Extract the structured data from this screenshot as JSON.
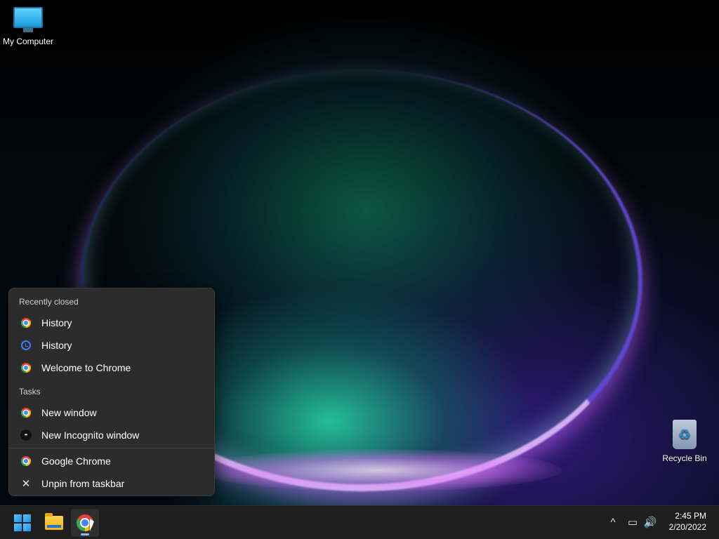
{
  "desktop": {
    "icons": [
      {
        "label": "My Computer",
        "icon": "monitor-icon"
      },
      {
        "label": "Recycle Bin",
        "icon": "recycle-bin-icon"
      }
    ]
  },
  "jumplist": {
    "recently_closed_title": "Recently closed",
    "recently_closed": [
      {
        "label": "History",
        "icon": "chrome-icon"
      },
      {
        "label": "History",
        "icon": "history-icon"
      },
      {
        "label": "Welcome to Chrome",
        "icon": "chrome-icon"
      }
    ],
    "tasks_title": "Tasks",
    "tasks": [
      {
        "label": "New window",
        "icon": "chrome-icon"
      },
      {
        "label": "New Incognito window",
        "icon": "incognito-icon"
      }
    ],
    "app": {
      "label": "Google Chrome",
      "icon": "chrome-icon"
    },
    "unpin": {
      "label": "Unpin from taskbar",
      "icon": "unpin-icon"
    }
  },
  "taskbar": {
    "buttons": [
      {
        "name": "start",
        "icon": "windows-logo-icon"
      },
      {
        "name": "file-explorer",
        "icon": "folder-icon"
      },
      {
        "name": "google-chrome",
        "icon": "chrome-icon",
        "active": true
      }
    ],
    "tray": {
      "chevron_glyph": "^",
      "network_glyph": "▭",
      "volume_glyph": "🔊"
    },
    "clock": {
      "time": "2:45 PM",
      "date": "2/20/2022"
    }
  },
  "colors": {
    "taskbar_bg": "#1e1e1e",
    "jumplist_bg": "#2c2c2c",
    "accent": "#8fb8ff"
  }
}
